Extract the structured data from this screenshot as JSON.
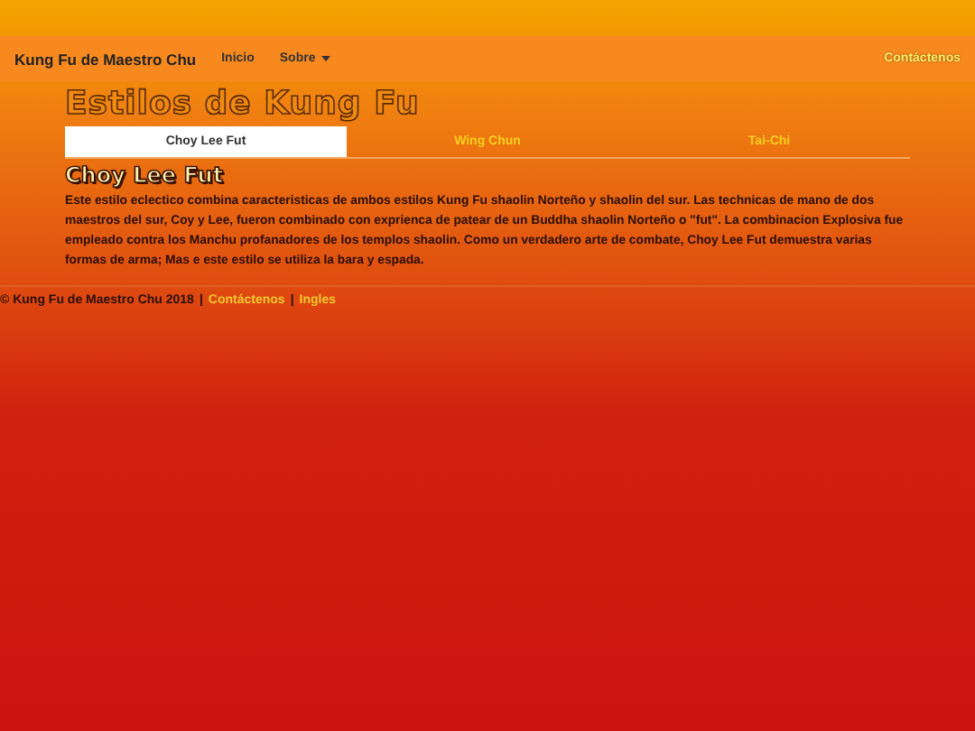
{
  "navbar": {
    "brand": "Kung Fu de Maestro Chu",
    "links": [
      {
        "label": "Inicio",
        "kind": "link"
      },
      {
        "label": "Sobre",
        "kind": "dropdown"
      }
    ],
    "right_link": "Contáctenos"
  },
  "page_title": "Estilos de Kung Fu",
  "tabs": [
    {
      "label": "Choy Lee Fut",
      "selected": true
    },
    {
      "label": "Wing Chun",
      "selected": false
    },
    {
      "label": "Tai-Chi",
      "selected": false
    }
  ],
  "section": {
    "heading": "Choy Lee Fut",
    "body": "Este estilo eclectico combina caracteristicas de ambos estilos Kung Fu shaolin Norteño y shaolin del sur. Las technicas de mano de dos maestros del sur, Coy y Lee, fueron combinado con exprienca de patear de un Buddha shaolin Norteño o \"fut\". La combinacion Explosiva fue empleado contra los Manchu profanadores de los templos shaolin. Como un verdadero arte de combate, Choy Lee Fut demuestra varias formas de arma; Mas e este estilo se utiliza la bara y espada."
  },
  "footer": {
    "copyright": "© Kung Fu de Maestro Chu 2018",
    "separator_1": "|",
    "link_1": "Contáctenos",
    "separator_2": "|",
    "link_2": "Ingles"
  }
}
